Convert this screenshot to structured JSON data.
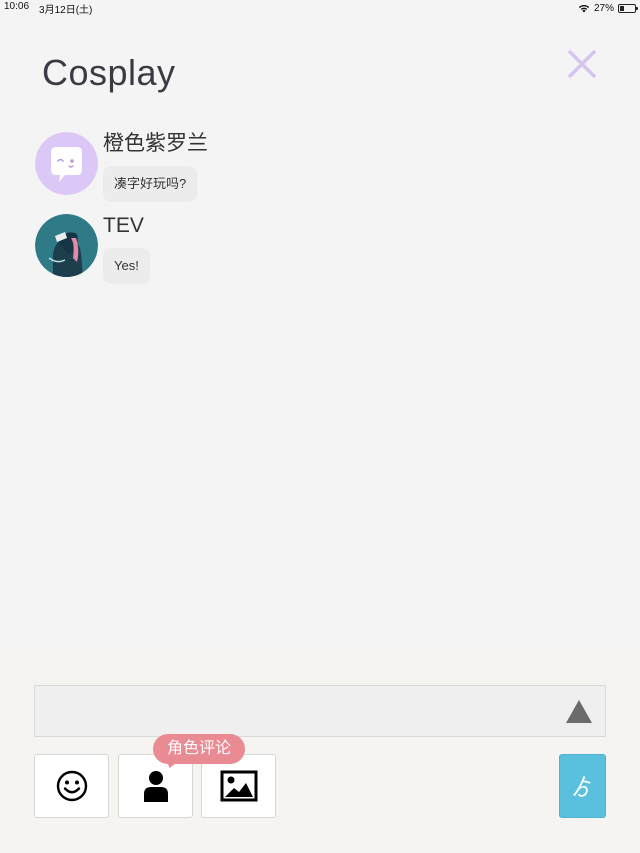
{
  "status_bar": {
    "time": "10:06",
    "date": "3月12日(土)",
    "battery": "27%",
    "battery_level": 0.27,
    "wifi_icon": "wifi-icon"
  },
  "header": {
    "title": "Cosplay",
    "close_icon": "close-icon",
    "close_color": "#d6c3ef"
  },
  "messages": [
    {
      "name": "橙色紫罗兰",
      "text": "凑字好玩吗?",
      "avatar": "speech-bubble-face-avatar",
      "avatar_color": "#dcc8f6"
    },
    {
      "name": "TEV",
      "text": "Yes!",
      "avatar": "illustrated-character-avatar",
      "avatar_color": "#2f7a87"
    }
  ],
  "composer": {
    "input_value": "",
    "input_placeholder": "",
    "expand_icon": "triangle-up-icon",
    "tools": [
      {
        "name": "emoji",
        "icon": "smiley-icon"
      },
      {
        "name": "character",
        "icon": "person-icon"
      },
      {
        "name": "image",
        "icon": "picture-icon"
      }
    ],
    "tooltip": "角色评论",
    "send_label": "ゟ",
    "send_color": "#5bc0de",
    "tooltip_color": "#ea8a92"
  }
}
